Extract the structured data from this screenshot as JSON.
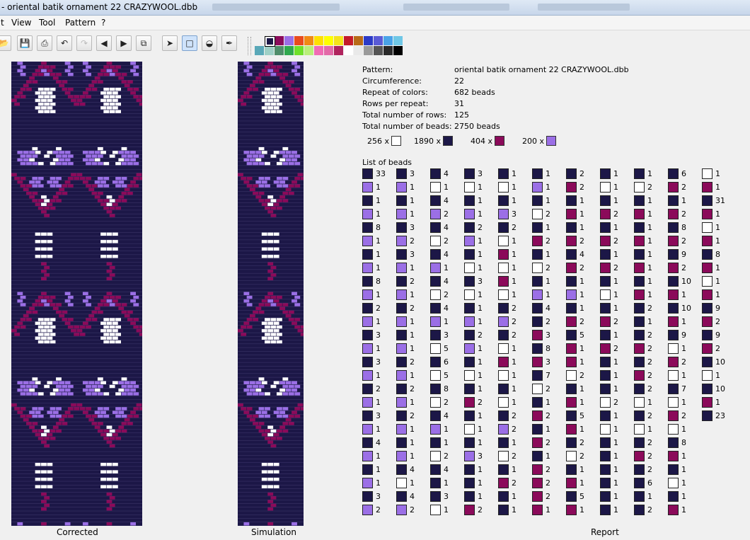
{
  "window": {
    "title": "- oriental batik ornament 22 CRAZYWOOL.dbb"
  },
  "menu": {
    "items": [
      "t",
      "View",
      "Tool",
      "Pattern",
      "?"
    ]
  },
  "toolbar": {
    "icons": [
      "open-icon",
      "save-icon",
      "print-icon",
      "undo-icon",
      "redo-icon",
      "arrow-left-icon",
      "arrow-right-icon",
      "copy-icon",
      "pointer-icon",
      "select-rect-icon",
      "fill-icon",
      "eyedropper-icon"
    ]
  },
  "palette": {
    "row1": [
      "#1c1747",
      "#8b0a5a",
      "#9b6fe6",
      "#e84b1d",
      "#f08a14",
      "#ffe000",
      "#ffff00",
      "#f5e31a",
      "#c41a2a",
      "#b86a17",
      "#2b3ac7",
      "#5a5bd6",
      "#4aa3e8",
      "#6fc7e6"
    ],
    "row2": [
      "#5aa8b8",
      "#9fd0c6",
      "#4f8d6a",
      "#2fa84e",
      "#6fe02a",
      "#b9ef7a",
      "#f06bb4",
      "#e36aa8",
      "#b0245e",
      "#ffffff",
      "#e9e9e9",
      "#9a9a9a",
      "#555555",
      "#2a2a2a",
      "#000000"
    ]
  },
  "colors": {
    "navy": "#1c1747",
    "purple": "#9b6fe6",
    "magenta": "#8b0a5a",
    "white": "#ffffff"
  },
  "captions": {
    "corrected": "Corrected",
    "simulation": "Simulation",
    "report": "Report"
  },
  "info": {
    "rows": [
      {
        "label": "Pattern:",
        "value": "oriental batik ornament 22 CRAZYWOOL.dbb"
      },
      {
        "label": "Circumference:",
        "value": "22"
      },
      {
        "label": "Repeat of colors:",
        "value": "682 beads"
      },
      {
        "label": "Rows per repeat:",
        "value": "31"
      },
      {
        "label": "Total number of rows:",
        "value": "125"
      },
      {
        "label": "Total number of beads:",
        "value": "2750 beads"
      }
    ],
    "counts": [
      {
        "count": "256 x",
        "color": "white"
      },
      {
        "count": "1890 x",
        "color": "navy"
      },
      {
        "count": "404 x",
        "color": "magenta"
      },
      {
        "count": "200 x",
        "color": "purple"
      }
    ],
    "list_label": "List of beads"
  },
  "bead_list": [
    [
      [
        "navy",
        "33"
      ],
      [
        "purple",
        "1"
      ],
      [
        "navy",
        "1"
      ],
      [
        "purple",
        "1"
      ],
      [
        "navy",
        "8"
      ],
      [
        "purple",
        "1"
      ],
      [
        "navy",
        "1"
      ],
      [
        "purple",
        "1"
      ],
      [
        "navy",
        "8"
      ],
      [
        "purple",
        "1"
      ],
      [
        "navy",
        "2"
      ],
      [
        "purple",
        "1"
      ],
      [
        "navy",
        "3"
      ],
      [
        "purple",
        "1"
      ],
      [
        "navy",
        "3"
      ],
      [
        "purple",
        "1"
      ],
      [
        "navy",
        "2"
      ],
      [
        "purple",
        "1"
      ],
      [
        "navy",
        "3"
      ],
      [
        "purple",
        "1"
      ],
      [
        "navy",
        "4"
      ],
      [
        "purple",
        "1"
      ],
      [
        "navy",
        "1"
      ],
      [
        "purple",
        "1"
      ],
      [
        "navy",
        "3"
      ],
      [
        "purple",
        "2"
      ]
    ],
    [
      [
        "navy",
        "3"
      ],
      [
        "purple",
        "1"
      ],
      [
        "navy",
        "1"
      ],
      [
        "purple",
        "1"
      ],
      [
        "navy",
        "3"
      ],
      [
        "purple",
        "2"
      ],
      [
        "navy",
        "3"
      ],
      [
        "purple",
        "1"
      ],
      [
        "navy",
        "2"
      ],
      [
        "purple",
        "1"
      ],
      [
        "navy",
        "2"
      ],
      [
        "purple",
        "1"
      ],
      [
        "navy",
        "1"
      ],
      [
        "purple",
        "1"
      ],
      [
        "navy",
        "2"
      ],
      [
        "purple",
        "1"
      ],
      [
        "navy",
        "2"
      ],
      [
        "purple",
        "1"
      ],
      [
        "navy",
        "2"
      ],
      [
        "purple",
        "1"
      ],
      [
        "navy",
        "1"
      ],
      [
        "purple",
        "1"
      ],
      [
        "navy",
        "4"
      ],
      [
        "white",
        "1"
      ],
      [
        "navy",
        "4"
      ],
      [
        "purple",
        "2"
      ]
    ],
    [
      [
        "navy",
        "4"
      ],
      [
        "white",
        "1"
      ],
      [
        "navy",
        "4"
      ],
      [
        "purple",
        "2"
      ],
      [
        "navy",
        "4"
      ],
      [
        "white",
        "2"
      ],
      [
        "navy",
        "4"
      ],
      [
        "purple",
        "1"
      ],
      [
        "navy",
        "4"
      ],
      [
        "white",
        "2"
      ],
      [
        "navy",
        "4"
      ],
      [
        "purple",
        "1"
      ],
      [
        "navy",
        "3"
      ],
      [
        "white",
        "5"
      ],
      [
        "navy",
        "6"
      ],
      [
        "white",
        "5"
      ],
      [
        "navy",
        "8"
      ],
      [
        "white",
        "2"
      ],
      [
        "navy",
        "4"
      ],
      [
        "purple",
        "1"
      ],
      [
        "navy",
        "1"
      ],
      [
        "white",
        "2"
      ],
      [
        "navy",
        "4"
      ],
      [
        "navy",
        "1"
      ],
      [
        "navy",
        "3"
      ],
      [
        "white",
        "1"
      ]
    ],
    [
      [
        "navy",
        "3"
      ],
      [
        "white",
        "1"
      ],
      [
        "navy",
        "1"
      ],
      [
        "purple",
        "1"
      ],
      [
        "navy",
        "2"
      ],
      [
        "purple",
        "1"
      ],
      [
        "navy",
        "1"
      ],
      [
        "white",
        "1"
      ],
      [
        "navy",
        "3"
      ],
      [
        "white",
        "1"
      ],
      [
        "navy",
        "1"
      ],
      [
        "purple",
        "1"
      ],
      [
        "navy",
        "2"
      ],
      [
        "purple",
        "1"
      ],
      [
        "navy",
        "1"
      ],
      [
        "white",
        "1"
      ],
      [
        "navy",
        "1"
      ],
      [
        "magenta",
        "2"
      ],
      [
        "navy",
        "1"
      ],
      [
        "white",
        "1"
      ],
      [
        "navy",
        "1"
      ],
      [
        "purple",
        "3"
      ],
      [
        "navy",
        "1"
      ],
      [
        "navy",
        "1"
      ],
      [
        "navy",
        "1"
      ],
      [
        "magenta",
        "2"
      ]
    ],
    [
      [
        "navy",
        "1"
      ],
      [
        "white",
        "1"
      ],
      [
        "navy",
        "1"
      ],
      [
        "purple",
        "3"
      ],
      [
        "navy",
        "2"
      ],
      [
        "white",
        "1"
      ],
      [
        "magenta",
        "1"
      ],
      [
        "white",
        "1"
      ],
      [
        "magenta",
        "1"
      ],
      [
        "white",
        "1"
      ],
      [
        "navy",
        "2"
      ],
      [
        "purple",
        "2"
      ],
      [
        "navy",
        "2"
      ],
      [
        "white",
        "1"
      ],
      [
        "magenta",
        "1"
      ],
      [
        "white",
        "1"
      ],
      [
        "navy",
        "1"
      ],
      [
        "white",
        "1"
      ],
      [
        "navy",
        "2"
      ],
      [
        "purple",
        "2"
      ],
      [
        "navy",
        "1"
      ],
      [
        "white",
        "2"
      ],
      [
        "navy",
        "1"
      ],
      [
        "magenta",
        "2"
      ],
      [
        "navy",
        "1"
      ],
      [
        "navy",
        "1"
      ]
    ],
    [
      [
        "navy",
        "1"
      ],
      [
        "purple",
        "1"
      ],
      [
        "navy",
        "1"
      ],
      [
        "white",
        "2"
      ],
      [
        "navy",
        "1"
      ],
      [
        "magenta",
        "2"
      ],
      [
        "navy",
        "1"
      ],
      [
        "white",
        "2"
      ],
      [
        "navy",
        "1"
      ],
      [
        "purple",
        "1"
      ],
      [
        "navy",
        "4"
      ],
      [
        "navy",
        "2"
      ],
      [
        "magenta",
        "3"
      ],
      [
        "navy",
        "8"
      ],
      [
        "magenta",
        "3"
      ],
      [
        "navy",
        "7"
      ],
      [
        "white",
        "2"
      ],
      [
        "navy",
        "1"
      ],
      [
        "magenta",
        "2"
      ],
      [
        "navy",
        "1"
      ],
      [
        "magenta",
        "2"
      ],
      [
        "navy",
        "1"
      ],
      [
        "magenta",
        "2"
      ],
      [
        "magenta",
        "2"
      ],
      [
        "magenta",
        "2"
      ],
      [
        "magenta",
        "1"
      ]
    ],
    [
      [
        "navy",
        "2"
      ],
      [
        "magenta",
        "2"
      ],
      [
        "navy",
        "1"
      ],
      [
        "magenta",
        "1"
      ],
      [
        "navy",
        "1"
      ],
      [
        "magenta",
        "2"
      ],
      [
        "navy",
        "4"
      ],
      [
        "magenta",
        "2"
      ],
      [
        "navy",
        "1"
      ],
      [
        "purple",
        "1"
      ],
      [
        "navy",
        "1"
      ],
      [
        "magenta",
        "2"
      ],
      [
        "navy",
        "5"
      ],
      [
        "magenta",
        "1"
      ],
      [
        "magenta",
        "1"
      ],
      [
        "white",
        "2"
      ],
      [
        "navy",
        "1"
      ],
      [
        "magenta",
        "1"
      ],
      [
        "navy",
        "5"
      ],
      [
        "magenta",
        "1"
      ],
      [
        "navy",
        "2"
      ],
      [
        "white",
        "2"
      ],
      [
        "navy",
        "1"
      ],
      [
        "magenta",
        "1"
      ],
      [
        "navy",
        "5"
      ],
      [
        "magenta",
        "1"
      ]
    ],
    [
      [
        "navy",
        "1"
      ],
      [
        "white",
        "1"
      ],
      [
        "navy",
        "1"
      ],
      [
        "magenta",
        "2"
      ],
      [
        "navy",
        "1"
      ],
      [
        "magenta",
        "2"
      ],
      [
        "navy",
        "1"
      ],
      [
        "magenta",
        "2"
      ],
      [
        "navy",
        "1"
      ],
      [
        "white",
        "1"
      ],
      [
        "navy",
        "1"
      ],
      [
        "magenta",
        "2"
      ],
      [
        "navy",
        "1"
      ],
      [
        "magenta",
        "2"
      ],
      [
        "navy",
        "1"
      ],
      [
        "navy",
        "1"
      ],
      [
        "navy",
        "1"
      ],
      [
        "white",
        "2"
      ],
      [
        "navy",
        "1"
      ],
      [
        "white",
        "1"
      ],
      [
        "navy",
        "1"
      ],
      [
        "navy",
        "1"
      ],
      [
        "navy",
        "1"
      ],
      [
        "navy",
        "1"
      ],
      [
        "navy",
        "1"
      ],
      [
        "navy",
        "1"
      ]
    ],
    [
      [
        "navy",
        "1"
      ],
      [
        "white",
        "2"
      ],
      [
        "navy",
        "1"
      ],
      [
        "magenta",
        "1"
      ],
      [
        "navy",
        "1"
      ],
      [
        "magenta",
        "1"
      ],
      [
        "navy",
        "1"
      ],
      [
        "magenta",
        "1"
      ],
      [
        "navy",
        "1"
      ],
      [
        "magenta",
        "1"
      ],
      [
        "navy",
        "2"
      ],
      [
        "navy",
        "1"
      ],
      [
        "navy",
        "2"
      ],
      [
        "magenta",
        "2"
      ],
      [
        "navy",
        "2"
      ],
      [
        "magenta",
        "2"
      ],
      [
        "navy",
        "2"
      ],
      [
        "white",
        "1"
      ],
      [
        "navy",
        "2"
      ],
      [
        "white",
        "1"
      ],
      [
        "navy",
        "2"
      ],
      [
        "magenta",
        "2"
      ],
      [
        "navy",
        "2"
      ],
      [
        "navy",
        "6"
      ],
      [
        "navy",
        "1"
      ],
      [
        "navy",
        "2"
      ]
    ],
    [
      [
        "navy",
        "6"
      ],
      [
        "magenta",
        "2"
      ],
      [
        "navy",
        "1"
      ],
      [
        "magenta",
        "2"
      ],
      [
        "navy",
        "8"
      ],
      [
        "magenta",
        "2"
      ],
      [
        "navy",
        "9"
      ],
      [
        "magenta",
        "2"
      ],
      [
        "navy",
        "10"
      ],
      [
        "magenta",
        "1"
      ],
      [
        "navy",
        "10"
      ],
      [
        "magenta",
        "1"
      ],
      [
        "navy",
        "9"
      ],
      [
        "white",
        "1"
      ],
      [
        "magenta",
        "2"
      ],
      [
        "white",
        "1"
      ],
      [
        "navy",
        "7"
      ],
      [
        "white",
        "1"
      ],
      [
        "magenta",
        "2"
      ],
      [
        "white",
        "1"
      ],
      [
        "navy",
        "8"
      ],
      [
        "magenta",
        "1"
      ],
      [
        "navy",
        "1"
      ],
      [
        "white",
        "1"
      ],
      [
        "navy",
        "1"
      ],
      [
        "magenta",
        "1"
      ]
    ],
    [
      [
        "white",
        "1"
      ],
      [
        "magenta",
        "1"
      ],
      [
        "navy",
        "31"
      ],
      [
        "magenta",
        "1"
      ],
      [
        "white",
        "1"
      ],
      [
        "magenta",
        "1"
      ],
      [
        "navy",
        "8"
      ],
      [
        "magenta",
        "1"
      ],
      [
        "white",
        "1"
      ],
      [
        "magenta",
        "1"
      ],
      [
        "navy",
        "9"
      ],
      [
        "magenta",
        "2"
      ],
      [
        "navy",
        "9"
      ],
      [
        "magenta",
        "2"
      ],
      [
        "navy",
        "10"
      ],
      [
        "white",
        "1"
      ],
      [
        "navy",
        "10"
      ],
      [
        "magenta",
        "1"
      ],
      [
        "navy",
        "23"
      ]
    ]
  ]
}
